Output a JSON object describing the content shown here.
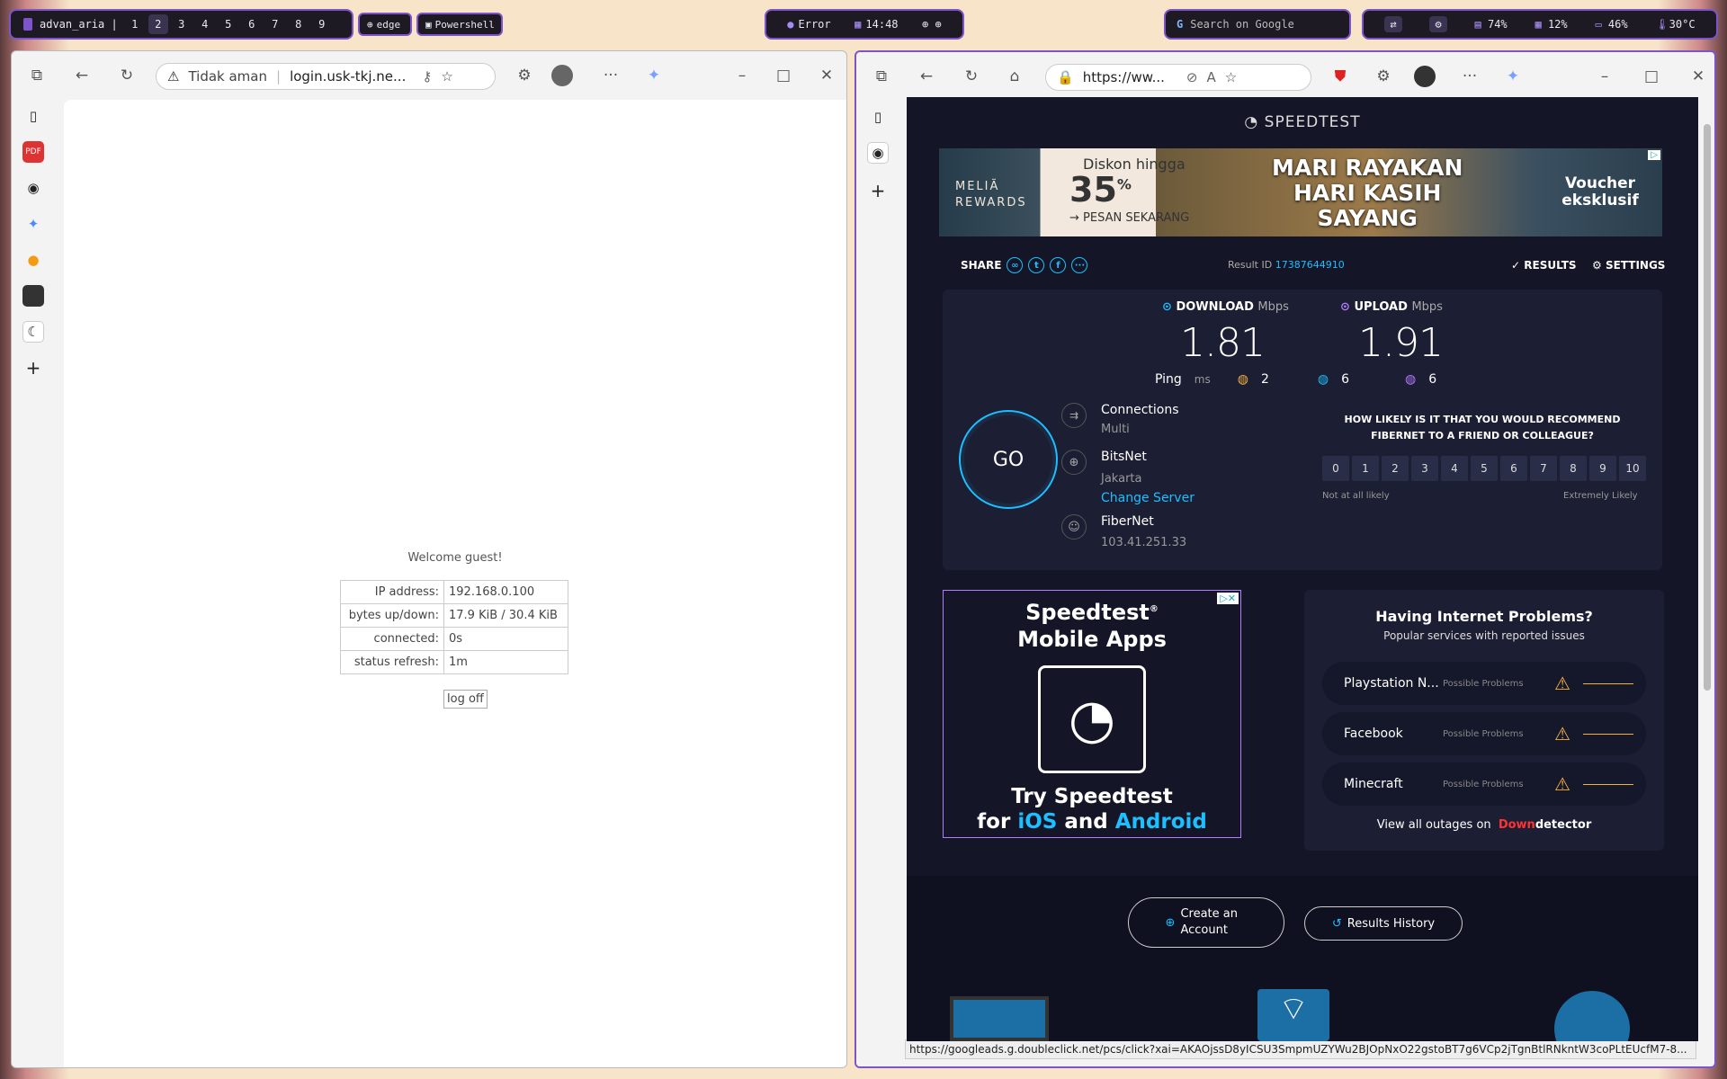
{
  "taskbar": {
    "user": "advan_aria |",
    "workspaces": [
      "1",
      "2",
      "3",
      "4",
      "5",
      "6",
      "7",
      "8",
      "9"
    ],
    "active_workspace": "2",
    "apps": [
      "edge",
      "Powershell"
    ],
    "error": "Error",
    "clock": "14:48",
    "search": "Search on Google",
    "cpu": "74%",
    "ram": "12%",
    "battery": "46%",
    "temp": "30°C"
  },
  "left_browser": {
    "security": "Tidak aman",
    "url": "login.usk-tkj.ne...",
    "welcome": "Welcome guest!",
    "rows": [
      {
        "k": "IP address:",
        "v": "192.168.0.100"
      },
      {
        "k": "bytes up/down:",
        "v": "17.9 KiB / 30.4 KiB"
      },
      {
        "k": "connected:",
        "v": "0s"
      },
      {
        "k": "status refresh:",
        "v": "1m"
      }
    ],
    "logoff": "log off"
  },
  "right_browser": {
    "url": "https://ww...",
    "status_url": "https://googleads.g.doubleclick.net/pcs/click?xai=AKAOjssD8yICSU3SmpmUZYWu2BJOpNxO22gstoBT7g6VCp2jTgnBtlRNkntW3coPLtEUcfM7-8..."
  },
  "speedtest": {
    "brand": "SPEEDTEST",
    "ad": {
      "brand": "MELIÃ REWARDS",
      "discount_label": "Diskon hingga",
      "discount": "35",
      "pct": "%",
      "cta": "→ PESAN SEKARANG",
      "headline1": "MARI RAYAKAN",
      "headline2": "HARI KASIH",
      "headline3": "SAYANG",
      "voucher1": "Voucher",
      "voucher2": "eksklusif"
    },
    "share": "SHARE",
    "result_id_label": "Result ID",
    "result_id": "17387644910",
    "results": "RESULTS",
    "settings": "SETTINGS",
    "download_label": "DOWNLOAD",
    "upload_label": "UPLOAD",
    "unit": "Mbps",
    "download": "1.81",
    "upload": "1.91",
    "ping_label": "Ping",
    "ping_unit": "ms",
    "ping_idle": "2",
    "ping_down": "6",
    "ping_up": "6",
    "go": "GO",
    "connections_label": "Connections",
    "connections_value": "Multi",
    "server_name": "BitsNet",
    "server_city": "Jakarta",
    "change_server": "Change Server",
    "isp": "FiberNet",
    "ip": "103.41.251.33",
    "nps_question": "HOW LIKELY IS IT THAT YOU WOULD RECOMMEND FIBERNET TO A FRIEND OR COLLEAGUE?",
    "nps": [
      "0",
      "1",
      "2",
      "3",
      "4",
      "5",
      "6",
      "7",
      "8",
      "9",
      "10"
    ],
    "nps_low": "Not at all likely",
    "nps_high": "Extremely Likely",
    "app_ad": {
      "title1": "Speedtest",
      "reg": "®",
      "title2": "Mobile Apps",
      "line1": "Try Speedtest",
      "line2_for": "for",
      "ios": "iOS",
      "and": "and",
      "android": "Android"
    },
    "problems": {
      "title": "Having Internet Problems?",
      "subtitle": "Popular services with reported issues",
      "items": [
        {
          "name": "Playstation N...",
          "status": "Possible Problems"
        },
        {
          "name": "Facebook",
          "status": "Possible Problems"
        },
        {
          "name": "Minecraft",
          "status": "Possible Problems"
        }
      ],
      "view_all": "View all outages on",
      "dd_red": "Down",
      "dd_white": "detector"
    },
    "create_account": "Create an Account",
    "results_history": "Results History"
  },
  "colors": {
    "accent": "#7d54c9",
    "speedtest_bg": "#141526",
    "cyan": "#1cbfff",
    "upload": "#b47cff"
  }
}
